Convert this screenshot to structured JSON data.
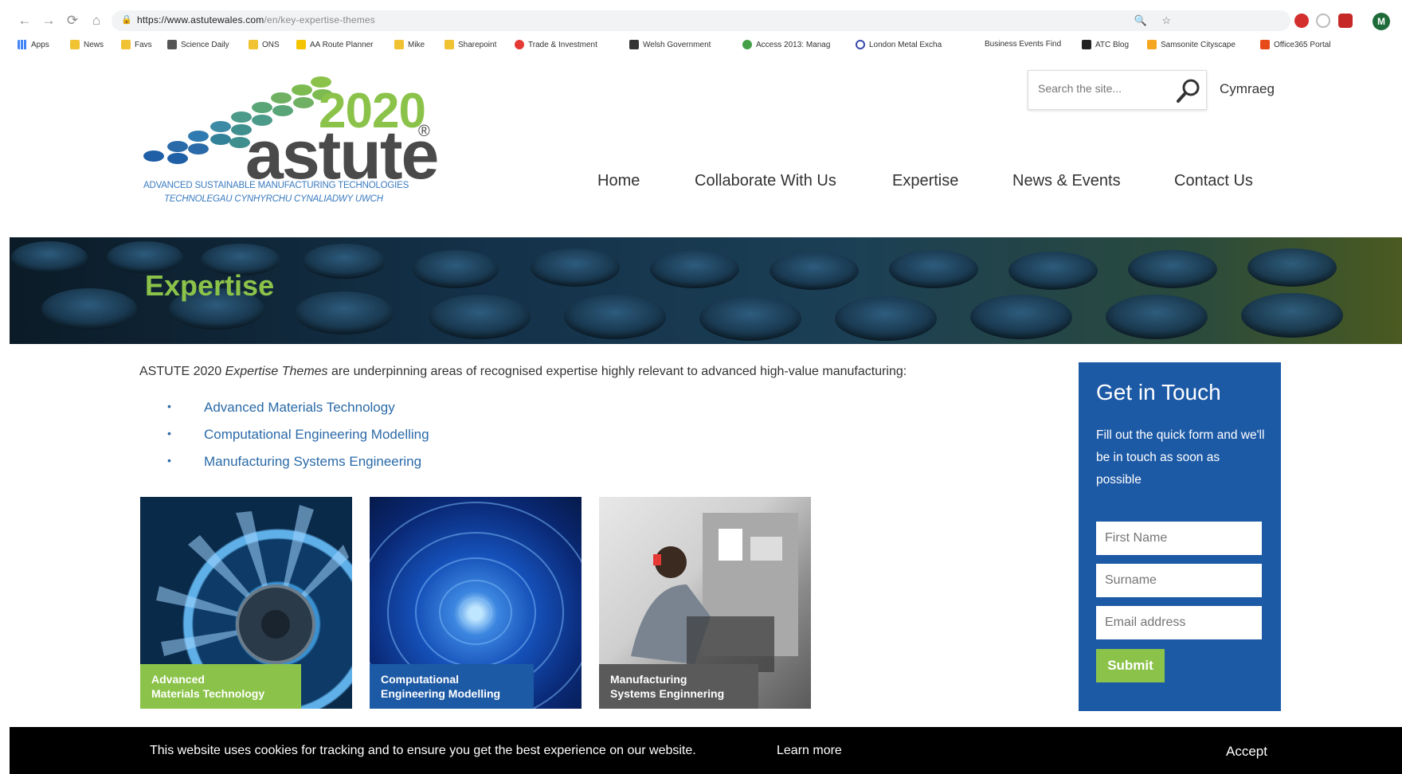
{
  "browser": {
    "url_host": "https://www.astutewales.com",
    "url_path": "/en/key-expertise-themes",
    "profile_initial": "M",
    "bookmarks": [
      "Apps",
      "News",
      "Favs",
      "Science Daily",
      "ONS",
      "AA Route Planner",
      "Mike",
      "Sharepoint",
      "Trade & Investment",
      "Welsh Government",
      "Access 2013: Manag",
      "London Metal Excha",
      "Business Events Find",
      "ATC Blog",
      "Samsonite Cityscape",
      "Office365 Portal"
    ]
  },
  "header": {
    "logo_year": "2020",
    "logo_name": "astute",
    "logo_reg": "®",
    "tagline_en": "ADVANCED SUSTAINABLE MANUFACTURING TECHNOLOGIES",
    "tagline_cy": "TECHNOLEGAU CYNHYRCHU CYNALIADWY UWCH",
    "search_placeholder": "Search the site...",
    "language": "Cymraeg",
    "nav": [
      "Home",
      "Collaborate With Us",
      "Expertise",
      "News & Events",
      "Contact Us"
    ]
  },
  "banner": {
    "title": "Expertise"
  },
  "main": {
    "intro_prefix": "ASTUTE 2020 ",
    "intro_em": "Expertise Themes",
    "intro_suffix": " are underpinning areas of recognised expertise highly relevant to advanced high-value manufacturing:",
    "themes": [
      "Advanced Materials Technology",
      "Computational Engineering Modelling",
      "Manufacturing Systems Engineering"
    ],
    "tiles": [
      {
        "caption": "Advanced\nMaterials Technology"
      },
      {
        "caption": "Computational\nEngineering Modelling"
      },
      {
        "caption": "Manufacturing\nSystems Enginnering"
      }
    ]
  },
  "sidebar": {
    "title": "Get in Touch",
    "description": "Fill out the quick form and we'll be in touch as soon as possible",
    "first_name_placeholder": "First Name",
    "surname_placeholder": "Surname",
    "email_placeholder": "Email address",
    "submit_label": "Submit"
  },
  "cookie": {
    "message": "This website uses cookies for tracking and to ensure you get the best experience on our website.",
    "learn_more": "Learn more",
    "accept": "Accept"
  },
  "colors": {
    "brand_green": "#8bc34a",
    "brand_blue": "#1d5aa6",
    "link_blue": "#2a6aa8"
  }
}
